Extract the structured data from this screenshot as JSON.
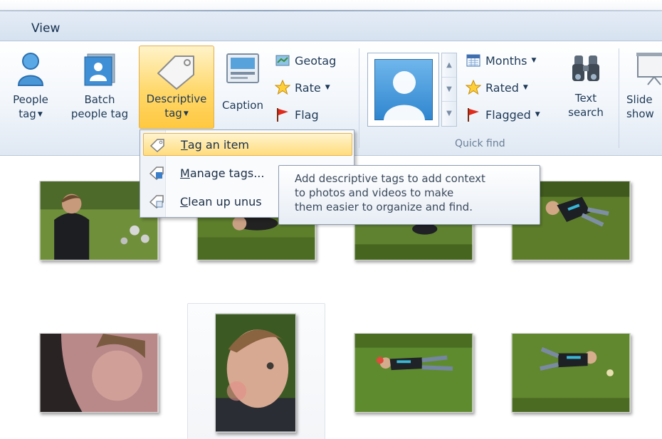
{
  "tabs": {
    "active": "View"
  },
  "ribbon": {
    "people_tag": {
      "line1": "People",
      "line2": "tag"
    },
    "batch_people_tag": {
      "line1": "Batch",
      "line2": "people tag"
    },
    "descriptive_tag": {
      "line1": "Descriptive",
      "line2": "tag"
    },
    "caption": "Caption",
    "geotag": "Geotag",
    "rate": "Rate",
    "flag": "Flag",
    "months": "Months",
    "rated": "Rated",
    "flagged": "Flagged",
    "text_search": {
      "line1": "Text",
      "line2": "search"
    },
    "slideshow": {
      "line1": "Slide",
      "line2": "show"
    },
    "quick_find_label": "Quick find"
  },
  "menu": {
    "items": [
      {
        "accel": "T",
        "rest": "ag an item",
        "icon": "tag-icon",
        "highlighted": true
      },
      {
        "accel": "M",
        "rest": "anage tags...",
        "icon": "manage-tags-icon",
        "highlighted": false
      },
      {
        "accel": "C",
        "rest": "lean up unus",
        "icon": "clean-up-tags-icon",
        "highlighted": false
      }
    ]
  },
  "tooltip": {
    "line1": "Add descriptive tags to add context",
    "line2": "to photos and videos to make",
    "line3": "them easier to organize and find."
  },
  "colors": {
    "ribbon_bg": "#f2f6fb",
    "highlight": "#ffd86a",
    "grass": "#5b7f2d"
  }
}
